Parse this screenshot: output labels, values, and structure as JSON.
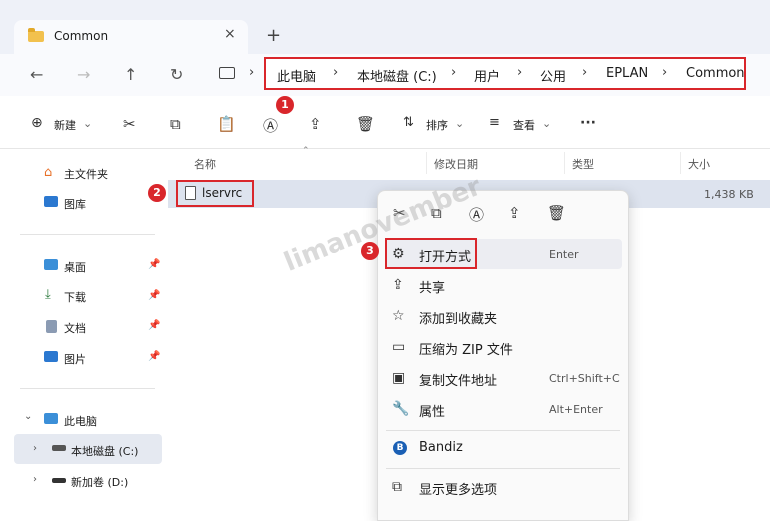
{
  "tab": {
    "title": "Common",
    "close": "×",
    "new_tab": "+"
  },
  "nav": {
    "back": "←",
    "forward": "→",
    "up": "↑",
    "refresh": "↻"
  },
  "breadcrumb": [
    "此电脑",
    "本地磁盘 (C:)",
    "用户",
    "公用",
    "EPLAN",
    "Common"
  ],
  "breadcrumb_sep": "›",
  "toolbar": {
    "new_label": "新建",
    "sort_label": "排序",
    "view_label": "查看",
    "more": "···"
  },
  "badges": [
    "1",
    "2",
    "3"
  ],
  "sidebar": {
    "pinned": [
      {
        "label": "主文件夹",
        "icon": "home-icon"
      },
      {
        "label": "图库",
        "icon": "gallery-icon"
      }
    ],
    "quick": [
      {
        "label": "桌面",
        "icon": "desktop-icon"
      },
      {
        "label": "下载",
        "icon": "download-icon"
      },
      {
        "label": "文档",
        "icon": "document-icon"
      },
      {
        "label": "图片",
        "icon": "pictures-icon"
      }
    ],
    "pc_label": "此电脑",
    "drives": [
      {
        "label": "本地磁盘 (C:)"
      },
      {
        "label": "新加卷 (D:)"
      }
    ]
  },
  "columns": {
    "name": "名称",
    "modified": "修改日期",
    "type": "类型",
    "size": "大小"
  },
  "file": {
    "name": "lservrc",
    "size": "1,438 KB"
  },
  "context_menu": {
    "items": [
      {
        "label": "打开方式",
        "shortcut": "Enter",
        "icon": "open-with-icon"
      },
      {
        "label": "共享",
        "shortcut": "",
        "icon": "share-icon"
      },
      {
        "label": "添加到收藏夹",
        "shortcut": "",
        "icon": "star-icon"
      },
      {
        "label": "压缩为 ZIP 文件",
        "shortcut": "",
        "icon": "zip-icon"
      },
      {
        "label": "复制文件地址",
        "shortcut": "Ctrl+Shift+C",
        "icon": "copy-path-icon"
      },
      {
        "label": "属性",
        "shortcut": "Alt+Enter",
        "icon": "properties-icon"
      }
    ],
    "bandiz": "Bandiz",
    "more_options": "显示更多选项"
  },
  "watermark": "limanovember",
  "colors": {
    "highlight_box": "#d9262b",
    "selected_row": "#dde3ee",
    "tab_bg": "#eef1f8"
  }
}
